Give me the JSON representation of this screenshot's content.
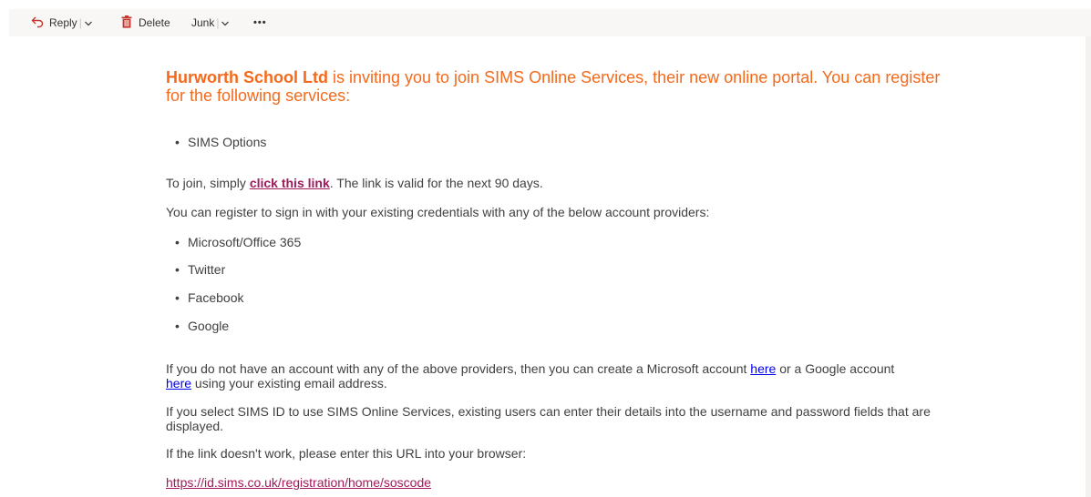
{
  "toolbar": {
    "reply_label": "Reply",
    "delete_label": "Delete",
    "junk_label": "Junk",
    "more_label": "•••",
    "separator": "|"
  },
  "email": {
    "headline_org": "Hurworth School Ltd",
    "headline_rest": " is inviting you to join SIMS Online Services, their new online portal. You can register for the following services:",
    "services": [
      "SIMS Options"
    ],
    "join_prefix": "To join, simply ",
    "join_link": "click this link",
    "join_suffix": ". The link is valid for the next 90 days.",
    "register_text": "You can register to sign in with your existing credentials with any of the below account providers:",
    "providers": [
      "Microsoft/Office 365",
      "Twitter",
      "Facebook",
      "Google"
    ],
    "no_account_1": "If you do not have an account with any of the above providers, then you can create a Microsoft account ",
    "here_1": "here",
    "no_account_2": " or a Google account ",
    "here_2": "here",
    "no_account_3": " using your existing email address.",
    "sims_id_text": "If you select SIMS ID to use SIMS Online Services, existing users can enter their details into the username and password fields that are displayed.",
    "link_fail_text": "If the link doesn't work, please enter this URL into your browser:",
    "url": "https://id.sims.co.uk/registration/home/soscode"
  },
  "colors": {
    "headline": "#f46a1d",
    "link_magenta": "#a2195b",
    "link_blue": "#0000ee",
    "toolbar_icon": "#c5372c",
    "body_text": "#404040"
  }
}
